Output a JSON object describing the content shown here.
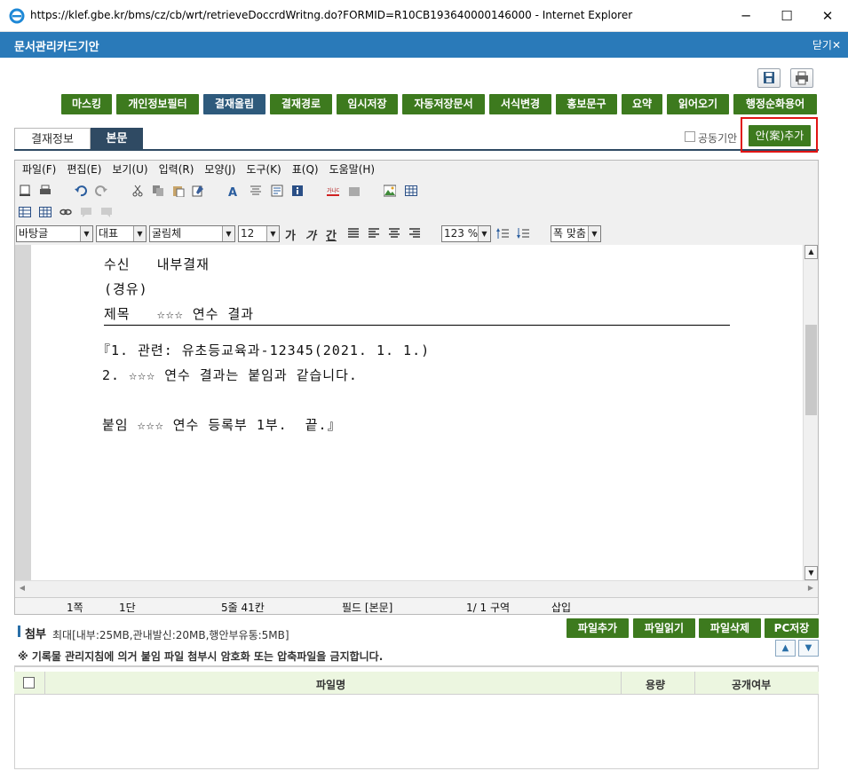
{
  "window": {
    "title": "https://klef.gbe.kr/bms/cz/cb/wrt/retrieveDoccrdWritng.do?FORMID=R10CB193640000146000 - Internet Explorer",
    "minimize": "─",
    "maximize": "☐",
    "close": "✕"
  },
  "app": {
    "title": "문서관리카드기안",
    "close_label": "닫기✕"
  },
  "toolbar": {
    "buttons": [
      "마스킹",
      "개인정보필터",
      "결재올림",
      "결재경로",
      "임시저장",
      "자동저장문서",
      "서식변경",
      "홍보문구",
      "요약",
      "읽어오기",
      "행정순화용어"
    ]
  },
  "tabs": [
    "결재정보",
    "본문"
  ],
  "joint_draft_label": "공동기안",
  "add_draft_label": "안(案)추가",
  "editor": {
    "menus": [
      "파일(F)",
      "편집(E)",
      "보기(U)",
      "입력(R)",
      "모양(J)",
      "도구(K)",
      "표(Q)",
      "도움말(H)"
    ],
    "style_select": "바탕글",
    "lang_select": "대표",
    "font_select": "굴림체",
    "size_select": "12",
    "format_bold": "가",
    "format_italic": "가",
    "format_underline": "간",
    "zoom_select": "123 %",
    "fit_select": "폭 맞춤",
    "doc_lines": {
      "recipient": "수신   내부결재",
      "via": "(경유)",
      "subject": "제목   ☆☆☆ 연수 결과",
      "body1": "『1. 관련: 유초등교육과-12345(2021. 1. 1.)",
      "body2": "2. ☆☆☆ 연수 결과는 붙임과 같습니다.",
      "attachment": "붙임 ☆☆☆ 연수 등록부 1부.  끝.』"
    },
    "status": {
      "page": "1쪽",
      "column": "1단",
      "line_col": "5줄    41칸",
      "field": "필드 [본문]",
      "section": "1/   1 구역",
      "mode": "삽입"
    }
  },
  "attachments": {
    "label": "첨부",
    "limits": "최대[내부:25MB,관내발신:20MB,행안부유통:5MB]",
    "notice": "※ 기록물 관리지침에 의거 붙임 파일 첨부시 암호화 또는 압축파일을 금지합니다.",
    "buttons": [
      "파일추가",
      "파일읽기",
      "파일삭제",
      "PC저장"
    ],
    "columns": {
      "name": "파일명",
      "size": "용량",
      "public": "공개여부"
    }
  }
}
